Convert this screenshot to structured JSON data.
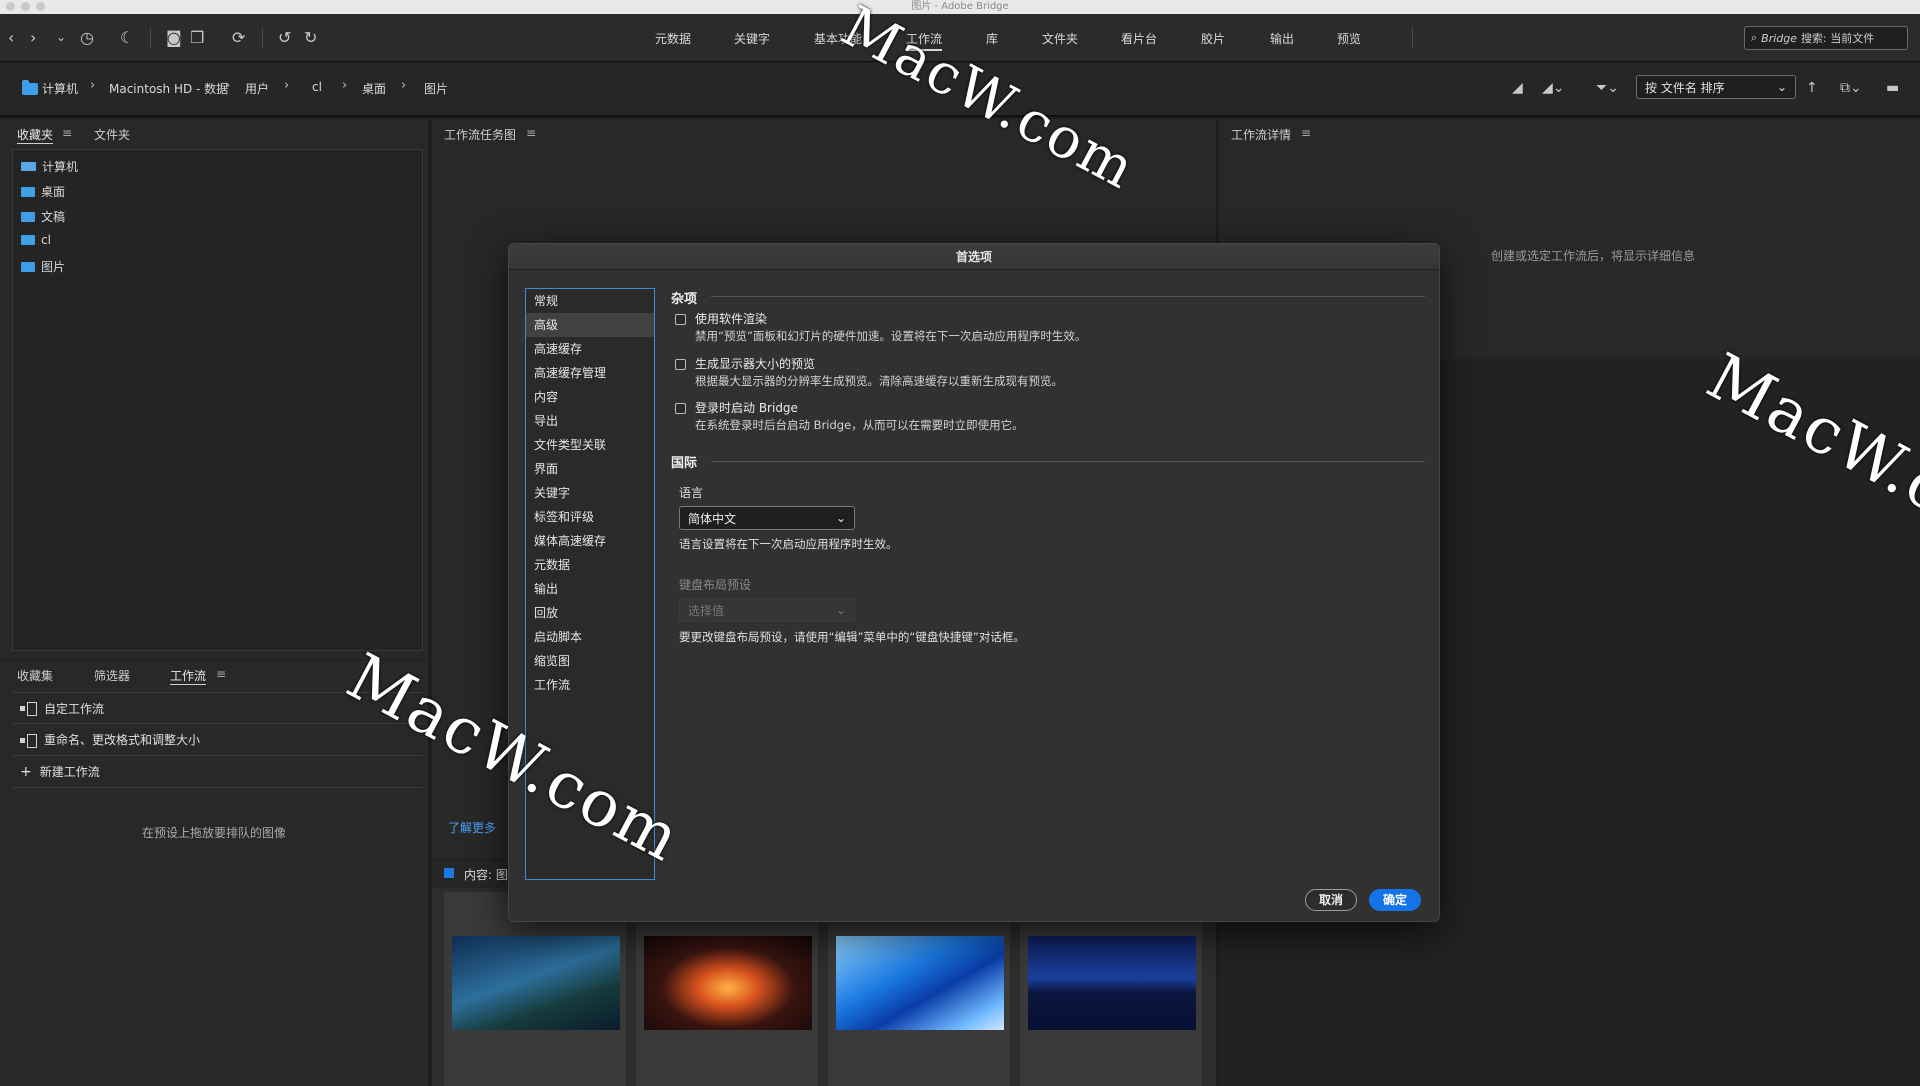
{
  "window": {
    "title": "图片 - Adobe Bridge"
  },
  "toolbar": {
    "workspaces": [
      {
        "label": "元数据"
      },
      {
        "label": "关键字"
      },
      {
        "label": "基本功能"
      },
      {
        "label": "工作流"
      },
      {
        "label": "库"
      },
      {
        "label": "文件夹"
      },
      {
        "label": "看片台"
      },
      {
        "label": "胶片"
      },
      {
        "label": "输出"
      },
      {
        "label": "预览"
      }
    ],
    "active_workspace": "工作流",
    "search": {
      "brand": "Bridge",
      "placeholder": "搜索: 当前文件"
    }
  },
  "pathbar": {
    "crumbs": [
      "计算机",
      "Macintosh HD - 数据",
      "用户",
      "cl",
      "桌面",
      "图片"
    ],
    "sort": {
      "value": "按 文件名 排序"
    }
  },
  "favorites_panel": {
    "tabs": [
      "收藏夹",
      "文件夹"
    ],
    "items": [
      {
        "label": "计算机",
        "icon": "computer-icon"
      },
      {
        "label": "桌面",
        "icon": "folder-icon"
      },
      {
        "label": "文稿",
        "icon": "folder-icon"
      },
      {
        "label": "cl",
        "icon": "folder-icon"
      },
      {
        "label": "图片",
        "icon": "folder-icon"
      }
    ]
  },
  "workflow_panel": {
    "tabs": [
      "收藏集",
      "筛选器",
      "工作流"
    ],
    "rows": [
      "自定工作流",
      "重命名、更改格式和调整大小"
    ],
    "new_label": "新建工作流",
    "hint": "在预设上拖放要排队的图像"
  },
  "center_panel": {
    "title": "工作流任务图",
    "learn_more": "了解更多",
    "content_label": "内容: 图"
  },
  "details_panel": {
    "title": "工作流详情",
    "empty_text": "创建或选定工作流后，将显示详细信息"
  },
  "dialog": {
    "title": "首选项",
    "categories": [
      "常规",
      "高级",
      "高速缓存",
      "高速缓存管理",
      "内容",
      "导出",
      "文件类型关联",
      "界面",
      "关键字",
      "标签和评级",
      "媒体高速缓存",
      "元数据",
      "输出",
      "回放",
      "启动脚本",
      "缩览图",
      "工作流"
    ],
    "selected_category": "高级",
    "misc": {
      "heading": "杂项",
      "options": [
        {
          "title": "使用软件渲染",
          "desc": "禁用“预览”面板和幻灯片的硬件加速。设置将在下一次启动应用程序时生效。",
          "checked": false
        },
        {
          "title": "生成显示器大小的预览",
          "desc": "根据最大显示器的分辨率生成预览。清除高速缓存以重新生成现有预览。",
          "checked": false
        },
        {
          "title": "登录时启动 Bridge",
          "desc": "在系统登录时后台启动 Bridge，从而可以在需要时立即使用它。",
          "checked": false
        }
      ]
    },
    "intl": {
      "heading": "国际",
      "language_label": "语言",
      "language_value": "简体中文",
      "language_note": "语言设置将在下一次启动应用程序时生效。",
      "keyboard_label": "键盘布局预设",
      "keyboard_value": "选择值",
      "keyboard_note": "要更改键盘布局预设，请使用“编辑”菜单中的“键盘快捷键”对话框。"
    },
    "buttons": {
      "cancel": "取消",
      "ok": "确定"
    }
  },
  "watermarks": [
    "MacW.com",
    "MacW.com",
    "MacW.c"
  ],
  "colors": {
    "accent": "#1473e6",
    "folder": "#3f9ee6",
    "selection_border": "#3f8ad8"
  }
}
